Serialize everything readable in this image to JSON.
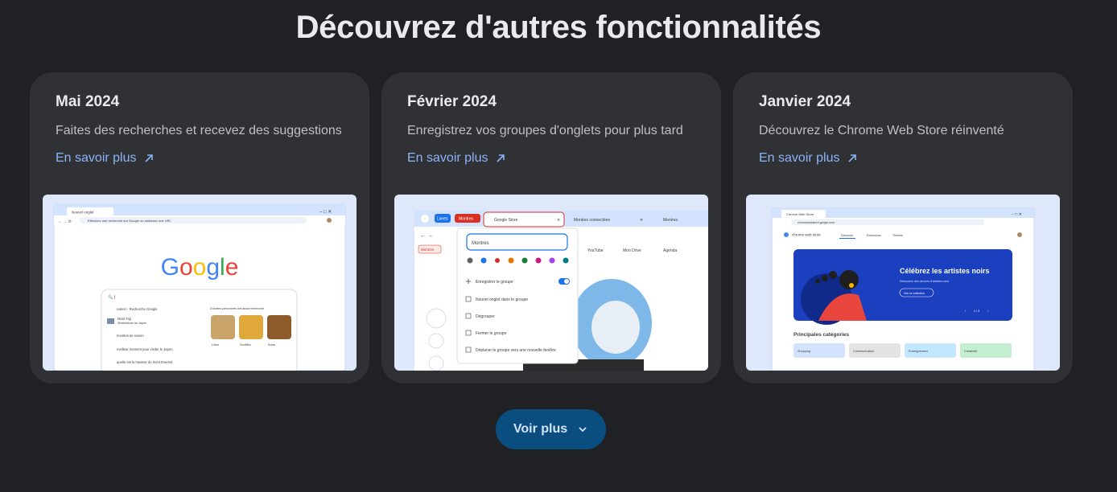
{
  "page": {
    "heading": "Découvrez d'autres fonctionnalités",
    "more_button": "Voir plus"
  },
  "cards": [
    {
      "date": "Mai 2024",
      "description": "Faites des recherches et recevez des suggestions",
      "link": "En savoir plus",
      "screenshot": {
        "tab_title": "Nouvel onglet",
        "address_text": "Effectuez une recherche sur Google ou saisissez une URL",
        "logo": "Google",
        "suggestions": [
          "ramen - Recherche Google",
          "Mont Fuji",
          "recettes de ramen",
          "meilleur moment pour visiter le Japon",
          "quelle est la hauteur du mont Everest"
        ],
        "suggestion_sub": "Stratovolcan au Japon",
        "related_header": "D'autres personnes ont aussi recherché",
        "related_items": [
          "Udon",
          "Soufflés",
          "Soba"
        ]
      }
    },
    {
      "date": "Février 2024",
      "description": "Enregistrez vos groupes d'onglets pour plus tard",
      "link": "En savoir plus",
      "screenshot": {
        "tab_groups": [
          "Livres",
          "Montres"
        ],
        "tabs": [
          "Google Store",
          "Montres connectées",
          "Montres"
        ],
        "bookmarks": [
          "Montres",
          "YouTube",
          "Mon Drive",
          "Agenda"
        ],
        "group_name_value": "Montres",
        "menu_items": [
          "Enregistrer le groupe",
          "Nouvel onglet dans le groupe",
          "Dégrouper",
          "Fermer le groupe",
          "Déplacer le groupe vers une nouvelle fenêtre"
        ],
        "swatch_colors": [
          "#5f6368",
          "#1a73e8",
          "#d93025",
          "#e37400",
          "#188038",
          "#d01884",
          "#a142f4",
          "#007b83"
        ]
      }
    },
    {
      "date": "Janvier 2024",
      "description": "Découvrez le Chrome Web Store réinventé",
      "link": "En savoir plus",
      "screenshot": {
        "tab_title": "Chrome Web Store",
        "address_text": "chromewebstore.google.com",
        "store_name": "chrome web store",
        "nav_items": [
          "Découvrir",
          "Extensions",
          "Thèmes"
        ],
        "banner_title": "Célébrez les artistes noirs",
        "banner_sub": "Découvrez des œuvres d'artistes noirs",
        "banner_button": "Voir la collection",
        "pager": "1 / 3",
        "categories_title": "Principales catégories",
        "categories": [
          "Shopping",
          "Communication",
          "Enseignement",
          "Créativité"
        ]
      }
    }
  ],
  "colors": {
    "background": "#202124",
    "card": "#303134",
    "link": "#8ab4f8",
    "button": "#0a4e80",
    "group_livres": "#1a73e8",
    "group_montres": "#d93025",
    "banner": "#1a3fbf"
  }
}
